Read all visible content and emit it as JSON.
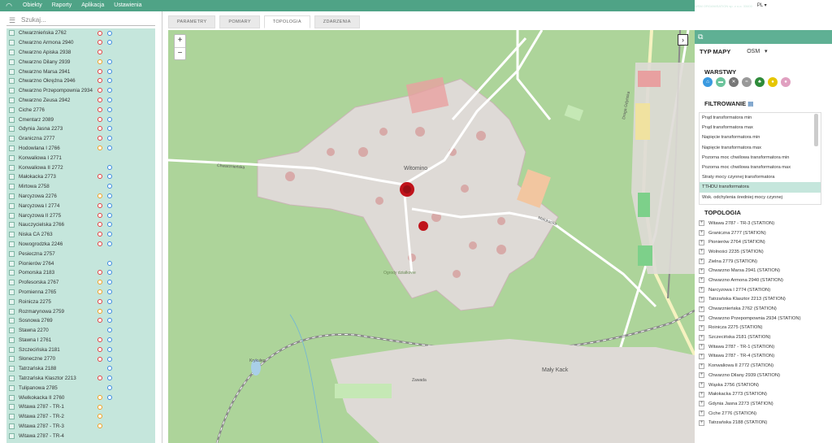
{
  "topbar": {
    "menu": [
      "Obiekty",
      "Raporty",
      "Aplikacja",
      "Ustawienia"
    ],
    "license": "WSM ORGANISATION sp. z o.o. 33400",
    "lang": "PL",
    "user_id": "01000255"
  },
  "left": {
    "search_placeholder": "Szukaj...",
    "objects": [
      {
        "name": "Chwarznieńska 2762",
        "ic1": "red",
        "ic2": "blue"
      },
      {
        "name": "Chwarzno Armona 2940",
        "ic1": "red",
        "ic2": "blue"
      },
      {
        "name": "Chwarzno Apiska 2938",
        "ic1": "red",
        "ic2": ""
      },
      {
        "name": "Chwarzno Dilany 2939",
        "ic1": "orange",
        "ic2": "blue"
      },
      {
        "name": "Chwarzno Marsa 2941",
        "ic1": "red",
        "ic2": "blue"
      },
      {
        "name": "Chwarzno Okrężna 2946",
        "ic1": "red",
        "ic2": "blue"
      },
      {
        "name": "Chwarzno Przepompownia 2934",
        "ic1": "red",
        "ic2": "blue"
      },
      {
        "name": "Chwarzno Zeusa 2942",
        "ic1": "red",
        "ic2": "blue"
      },
      {
        "name": "Ciche 2776",
        "ic1": "red",
        "ic2": "blue"
      },
      {
        "name": "Cmentarz 2089",
        "ic1": "red",
        "ic2": "blue"
      },
      {
        "name": "Gdynia Jasna 2273",
        "ic1": "red",
        "ic2": "blue"
      },
      {
        "name": "Graniczna 2777",
        "ic1": "red",
        "ic2": "blue"
      },
      {
        "name": "Hodowlana I 2766",
        "ic1": "orange",
        "ic2": "blue"
      },
      {
        "name": "Konwaliowa I 2771",
        "ic1": "",
        "ic2": ""
      },
      {
        "name": "Konwaliowa II 2772",
        "ic1": "",
        "ic2": "blue"
      },
      {
        "name": "Małokacka 2773",
        "ic1": "red",
        "ic2": "blue"
      },
      {
        "name": "Mirtowa 2758",
        "ic1": "",
        "ic2": "blue"
      },
      {
        "name": "Narcyzowa 2276",
        "ic1": "orange",
        "ic2": "blue"
      },
      {
        "name": "Narcyzowa I 2774",
        "ic1": "red",
        "ic2": "blue"
      },
      {
        "name": "Narcyzowa II 2775",
        "ic1": "red",
        "ic2": "blue"
      },
      {
        "name": "Nauczycielska 2766",
        "ic1": "red",
        "ic2": "blue"
      },
      {
        "name": "Niska CA 2763",
        "ic1": "red",
        "ic2": "blue"
      },
      {
        "name": "Nowogrodzka 2246",
        "ic1": "red",
        "ic2": "blue"
      },
      {
        "name": "Pesieczna 2757",
        "ic1": "",
        "ic2": ""
      },
      {
        "name": "Pionierów 2764",
        "ic1": "",
        "ic2": "blue"
      },
      {
        "name": "Pomorska 2183",
        "ic1": "red",
        "ic2": "blue"
      },
      {
        "name": "Profesorska 2767",
        "ic1": "orange",
        "ic2": "blue"
      },
      {
        "name": "Promienna 2765",
        "ic1": "orange",
        "ic2": "blue"
      },
      {
        "name": "Roinicza 2275",
        "ic1": "red",
        "ic2": "blue"
      },
      {
        "name": "Rozmarynowa 2759",
        "ic1": "orange",
        "ic2": "blue"
      },
      {
        "name": "Sosnowa 2769",
        "ic1": "red",
        "ic2": "blue"
      },
      {
        "name": "Stawna 2270",
        "ic1": "",
        "ic2": "blue"
      },
      {
        "name": "Stawna I 2761",
        "ic1": "red",
        "ic2": "blue"
      },
      {
        "name": "Szczecińska 2181",
        "ic1": "red",
        "ic2": "blue"
      },
      {
        "name": "Słoneczne 2770",
        "ic1": "red",
        "ic2": "blue"
      },
      {
        "name": "Tatrzańska 2188",
        "ic1": "",
        "ic2": "blue"
      },
      {
        "name": "Tatrzańska Klasztor 2213",
        "ic1": "red",
        "ic2": "blue"
      },
      {
        "name": "Tulipanowa 2785",
        "ic1": "",
        "ic2": "blue"
      },
      {
        "name": "Wielkokacka II 2760",
        "ic1": "orange",
        "ic2": "blue"
      },
      {
        "name": "Witawa 2787 - TR-1",
        "ic1": "orange",
        "ic2": ""
      },
      {
        "name": "Witawa 2787 - TR-2",
        "ic1": "orange",
        "ic2": ""
      },
      {
        "name": "Witawa 2787 - TR-3",
        "ic1": "orange",
        "ic2": ""
      },
      {
        "name": "Witawa 2787 - TR-4",
        "ic1": "",
        "ic2": ""
      }
    ]
  },
  "tabs": [
    "PARAMETRY",
    "POMIARY",
    "TOPOLOGIA",
    "ZDARZENIA"
  ],
  "map": {
    "labels": {
      "witomino": "Witomino",
      "chwarznienska": "Chwarznieńska",
      "malokacka": "Małokacka",
      "malykack": "Mały Kack",
      "zawada": "Zawada",
      "ogrody": "Ogrody działkowe",
      "droga": "Droga Gdyńska",
      "kryk": "Krykulec"
    },
    "zoom_in": "+",
    "zoom_out": "−",
    "toggle": "›"
  },
  "right": {
    "maptype_label": "TYP MAPY",
    "maptype_value": "OSM",
    "layers_label": "WARSTWY",
    "layers": [
      {
        "name": "station-icon",
        "color": "#3a9ae0",
        "glyph": "⌂"
      },
      {
        "name": "trash-icon",
        "color": "#6cc49c",
        "glyph": "▬"
      },
      {
        "name": "tool-icon",
        "color": "#777777",
        "glyph": "✕"
      },
      {
        "name": "cable-icon",
        "color": "#999999",
        "glyph": "≈"
      },
      {
        "name": "leaf-icon",
        "color": "#2e8b3a",
        "glyph": "♣"
      },
      {
        "name": "bulb-icon",
        "color": "#e6c600",
        "glyph": "●"
      },
      {
        "name": "drop-icon",
        "color": "#e0a0c0",
        "glyph": "●"
      }
    ],
    "filter_label": "FILTROWANIE",
    "filters": [
      "Prąd transformatora min",
      "Prąd transformatora max",
      "Napięcie transformatora min",
      "Napięcie transformatora max",
      "Pozorna moc chwilowa transformatora min",
      "Pozorna moc chwilowa transformatora max",
      "Straty mocy czynnej transformatora",
      "TTHDU transformatora",
      "Wsk. odchylenia średniej mocy czynnej"
    ],
    "selected_filter": 7,
    "topology_label": "TOPOLOGIA",
    "topology": [
      "Witawa 2787 - TR-3 (STATION)",
      "Graniczna 2777 (STATION)",
      "Pionierów 2764 (STATION)",
      "Wolności 2235 (STATION)",
      "Zielna 2779 (STATION)",
      "Chwarzno Marsa 2941 (STATION)",
      "Chwarzno Armona 2940 (STATION)",
      "Narcyzowa I 2774 (STATION)",
      "Tatrzańska Klasztor 2213 (STATION)",
      "Chwarznieńska 2762 (STATION)",
      "Chwarzno Przepompownia 2934 (STATION)",
      "Roinicza 2275 (STATION)",
      "Szczecińska 2181 (STATION)",
      "Witawa 2787 - TR-1 (STATION)",
      "Witawa 2787 - TR-4 (STATION)",
      "Konwaliowa II 2772 (STATION)",
      "Chwarzno Dilany 2939 (STATION)",
      "Wąska 2756 (STATION)",
      "Małokacka 2773 (STATION)",
      "Gdynia Jasna 2273 (STATION)",
      "Ciche 2776 (STATION)",
      "Tatrzańska 2188 (STATION)"
    ]
  }
}
